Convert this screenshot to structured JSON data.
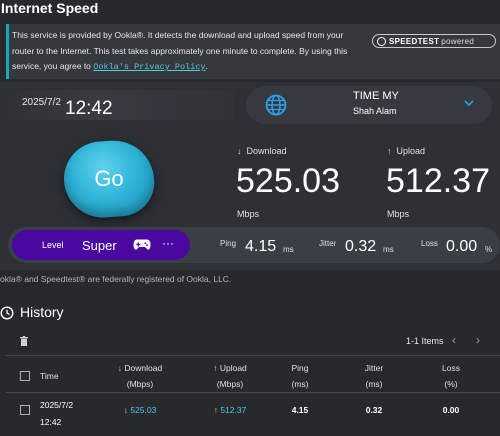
{
  "page": {
    "title": "Internet Speed"
  },
  "info": {
    "text": "This service is provided by Ookla®. It detects the download and upload speed from your router to the Internet. This test takes approximately one minute to complete. By using this service, you agree to",
    "link": "Ookla's Privacy Policy",
    "period": "."
  },
  "logo": {
    "brand": "SPEEDTEST",
    "suffix": "powered"
  },
  "test": {
    "date": "2025/7/2",
    "time": "12:42",
    "go_label": "Go"
  },
  "server": {
    "name": "TIME MY",
    "location": "Shah Alam"
  },
  "download": {
    "label": "Download",
    "value": "525.03",
    "unit": "Mbps"
  },
  "upload": {
    "label": "Upload",
    "value": "512.37",
    "unit": "Mbps"
  },
  "level": {
    "label": "Level",
    "value": "Super",
    "more": "···"
  },
  "stats": {
    "ping_label": "Ping",
    "ping_value": "4.15",
    "ping_unit": "ms",
    "jitter_label": "Jitter",
    "jitter_value": "0.32",
    "jitter_unit": "ms",
    "loss_label": "Loss",
    "loss_value": "0.00",
    "loss_unit": "%"
  },
  "footnote": "okla® and Speedtest® are federally registered of Ookla, LLC.",
  "history": {
    "title": "History",
    "items_count": "1-1 Items",
    "columns": {
      "time": "Time",
      "download": "Download",
      "download_unit": "(Mbps)",
      "upload": "Upload",
      "upload_unit": "(Mbps)",
      "ping": "Ping",
      "ping_unit": "(ms)",
      "jitter": "Jitter",
      "jitter_unit": "(ms)",
      "loss": "Loss",
      "loss_unit": "(%)"
    },
    "rows": [
      {
        "date": "2025/7/2",
        "time": "12:42",
        "download": "525.03",
        "upload": "512.37",
        "ping": "4.15",
        "jitter": "0.32",
        "loss": "0.00"
      }
    ]
  },
  "icons": {
    "arrow_down": "↓",
    "arrow_up": "↑",
    "prev": "‹",
    "next": "›"
  },
  "colors": {
    "background": "#27292d",
    "accent": "#14a7c2",
    "link": "#53c8e0",
    "level_pill": "#4a08a0",
    "go_button": "#2fb4d8"
  }
}
